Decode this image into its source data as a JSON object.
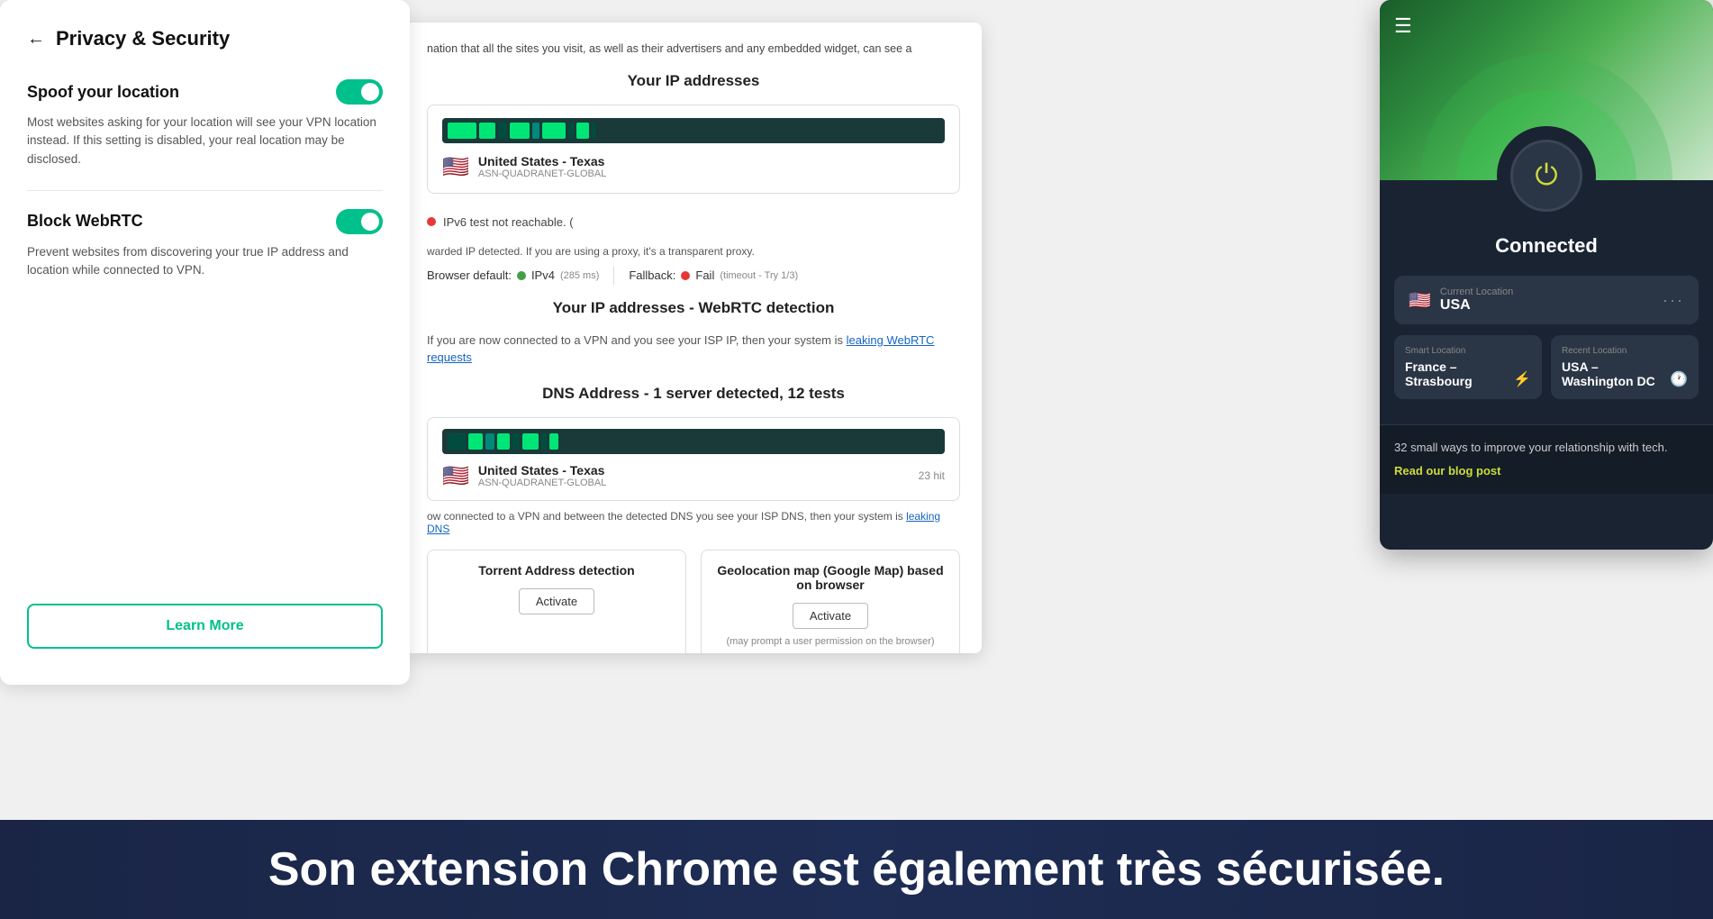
{
  "privacy_panel": {
    "title": "Privacy & Security",
    "back_label": "←",
    "spoof_location": {
      "label": "Spoof your location",
      "description": "Most websites asking for your location will see your VPN location instead. If this setting is disabled, your real location may be disclosed.",
      "enabled": true
    },
    "block_webrtc": {
      "label": "Block WebRTC",
      "description": "Prevent websites from discovering your true IP address and location while connected to VPN.",
      "enabled": true
    },
    "learn_more_btn": "Learn More"
  },
  "ip_panel": {
    "top_text": "nation that all the sites you visit, as well as their advertisers and any embedded widget, can see a",
    "sections": {
      "your_ip": {
        "title": "Your IP addresses",
        "location": "United States - Texas",
        "asn": "ASN-QUADRANET-GLOBAL",
        "ipv6_text": "IPv6 test not reachable. (",
        "warning_text": "warded IP detected. If you are using a proxy, it's a transparent proxy.",
        "browser_default": "Browser default:",
        "ipv4_label": "IPv4",
        "ipv4_ms": "(285 ms)",
        "fallback_label": "Fallback:",
        "fallback_status": "Fail",
        "fallback_note": "(timeout - Try 1/3)"
      },
      "webrtc": {
        "title": "Your IP addresses - WebRTC detection",
        "text": "If you are now connected to a VPN and you see your ISP IP, then your system is",
        "link_text": "leaking WebRTC requests"
      },
      "dns": {
        "title": "DNS Address - 1 server detected, 12 tests",
        "location": "United States - Texas",
        "asn": "ASN-QUADRANET-GLOBAL",
        "hits": "23 hit",
        "leak_text": "ow connected to a VPN and between the detected DNS you see your ISP DNS, then your system is",
        "leak_link": "leaking DNS"
      },
      "torrent": {
        "title": "Torrent Address detection",
        "activate_btn": "Activate"
      },
      "geolocation": {
        "title": "Geolocation map (Google Map) based on browser",
        "activate_btn": "Activate",
        "note": "(may prompt a user permission on the browser)"
      }
    }
  },
  "vpn_panel": {
    "status": "Connected",
    "current_location_label": "Current Location",
    "current_location": "USA",
    "smart_location_label": "Smart Location",
    "smart_location": "France –\nStrasbourg",
    "recent_location_label": "Recent Location",
    "recent_location": "USA –\nWashington DC",
    "blog_text": "32 small ways to improve your relationship with tech.",
    "blog_link": "Read our blog post"
  },
  "banner": {
    "text": "Son extension Chrome est également très sécurisée."
  }
}
